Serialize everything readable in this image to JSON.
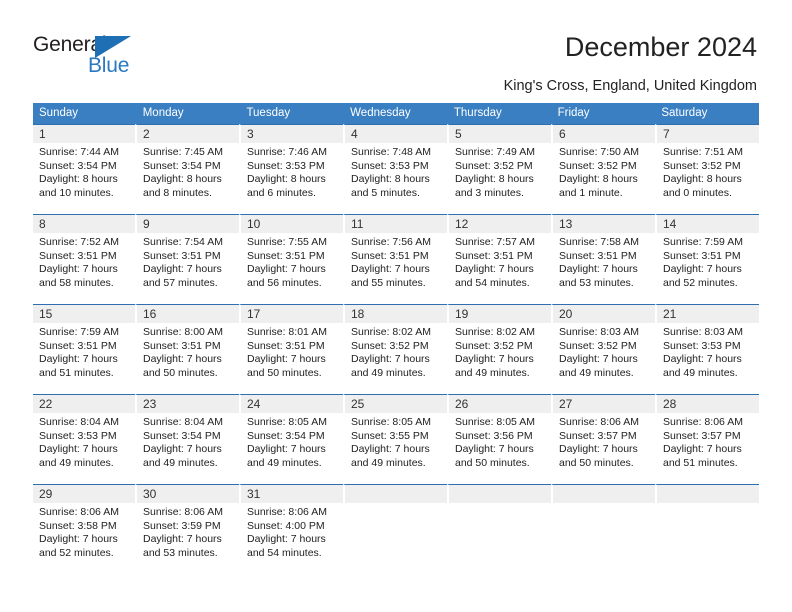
{
  "brand": {
    "name_top": "General",
    "name_bottom": "Blue",
    "accent_color": "#1f6fb4"
  },
  "header": {
    "title": "December 2024",
    "subtitle": "King's Cross, England, United Kingdom"
  },
  "calendar": {
    "header_bg": "#3a7fc1",
    "cell_header_bg": "#efefef",
    "cell_border_color": "#2f6fb0",
    "weekdays": [
      "Sunday",
      "Monday",
      "Tuesday",
      "Wednesday",
      "Thursday",
      "Friday",
      "Saturday"
    ],
    "weeks": [
      [
        {
          "day": "1",
          "sunrise": "Sunrise: 7:44 AM",
          "sunset": "Sunset: 3:54 PM",
          "daylight_line1": "Daylight: 8 hours",
          "daylight_line2": "and 10 minutes."
        },
        {
          "day": "2",
          "sunrise": "Sunrise: 7:45 AM",
          "sunset": "Sunset: 3:54 PM",
          "daylight_line1": "Daylight: 8 hours",
          "daylight_line2": "and 8 minutes."
        },
        {
          "day": "3",
          "sunrise": "Sunrise: 7:46 AM",
          "sunset": "Sunset: 3:53 PM",
          "daylight_line1": "Daylight: 8 hours",
          "daylight_line2": "and 6 minutes."
        },
        {
          "day": "4",
          "sunrise": "Sunrise: 7:48 AM",
          "sunset": "Sunset: 3:53 PM",
          "daylight_line1": "Daylight: 8 hours",
          "daylight_line2": "and 5 minutes."
        },
        {
          "day": "5",
          "sunrise": "Sunrise: 7:49 AM",
          "sunset": "Sunset: 3:52 PM",
          "daylight_line1": "Daylight: 8 hours",
          "daylight_line2": "and 3 minutes."
        },
        {
          "day": "6",
          "sunrise": "Sunrise: 7:50 AM",
          "sunset": "Sunset: 3:52 PM",
          "daylight_line1": "Daylight: 8 hours",
          "daylight_line2": "and 1 minute."
        },
        {
          "day": "7",
          "sunrise": "Sunrise: 7:51 AM",
          "sunset": "Sunset: 3:52 PM",
          "daylight_line1": "Daylight: 8 hours",
          "daylight_line2": "and 0 minutes."
        }
      ],
      [
        {
          "day": "8",
          "sunrise": "Sunrise: 7:52 AM",
          "sunset": "Sunset: 3:51 PM",
          "daylight_line1": "Daylight: 7 hours",
          "daylight_line2": "and 58 minutes."
        },
        {
          "day": "9",
          "sunrise": "Sunrise: 7:54 AM",
          "sunset": "Sunset: 3:51 PM",
          "daylight_line1": "Daylight: 7 hours",
          "daylight_line2": "and 57 minutes."
        },
        {
          "day": "10",
          "sunrise": "Sunrise: 7:55 AM",
          "sunset": "Sunset: 3:51 PM",
          "daylight_line1": "Daylight: 7 hours",
          "daylight_line2": "and 56 minutes."
        },
        {
          "day": "11",
          "sunrise": "Sunrise: 7:56 AM",
          "sunset": "Sunset: 3:51 PM",
          "daylight_line1": "Daylight: 7 hours",
          "daylight_line2": "and 55 minutes."
        },
        {
          "day": "12",
          "sunrise": "Sunrise: 7:57 AM",
          "sunset": "Sunset: 3:51 PM",
          "daylight_line1": "Daylight: 7 hours",
          "daylight_line2": "and 54 minutes."
        },
        {
          "day": "13",
          "sunrise": "Sunrise: 7:58 AM",
          "sunset": "Sunset: 3:51 PM",
          "daylight_line1": "Daylight: 7 hours",
          "daylight_line2": "and 53 minutes."
        },
        {
          "day": "14",
          "sunrise": "Sunrise: 7:59 AM",
          "sunset": "Sunset: 3:51 PM",
          "daylight_line1": "Daylight: 7 hours",
          "daylight_line2": "and 52 minutes."
        }
      ],
      [
        {
          "day": "15",
          "sunrise": "Sunrise: 7:59 AM",
          "sunset": "Sunset: 3:51 PM",
          "daylight_line1": "Daylight: 7 hours",
          "daylight_line2": "and 51 minutes."
        },
        {
          "day": "16",
          "sunrise": "Sunrise: 8:00 AM",
          "sunset": "Sunset: 3:51 PM",
          "daylight_line1": "Daylight: 7 hours",
          "daylight_line2": "and 50 minutes."
        },
        {
          "day": "17",
          "sunrise": "Sunrise: 8:01 AM",
          "sunset": "Sunset: 3:51 PM",
          "daylight_line1": "Daylight: 7 hours",
          "daylight_line2": "and 50 minutes."
        },
        {
          "day": "18",
          "sunrise": "Sunrise: 8:02 AM",
          "sunset": "Sunset: 3:52 PM",
          "daylight_line1": "Daylight: 7 hours",
          "daylight_line2": "and 49 minutes."
        },
        {
          "day": "19",
          "sunrise": "Sunrise: 8:02 AM",
          "sunset": "Sunset: 3:52 PM",
          "daylight_line1": "Daylight: 7 hours",
          "daylight_line2": "and 49 minutes."
        },
        {
          "day": "20",
          "sunrise": "Sunrise: 8:03 AM",
          "sunset": "Sunset: 3:52 PM",
          "daylight_line1": "Daylight: 7 hours",
          "daylight_line2": "and 49 minutes."
        },
        {
          "day": "21",
          "sunrise": "Sunrise: 8:03 AM",
          "sunset": "Sunset: 3:53 PM",
          "daylight_line1": "Daylight: 7 hours",
          "daylight_line2": "and 49 minutes."
        }
      ],
      [
        {
          "day": "22",
          "sunrise": "Sunrise: 8:04 AM",
          "sunset": "Sunset: 3:53 PM",
          "daylight_line1": "Daylight: 7 hours",
          "daylight_line2": "and 49 minutes."
        },
        {
          "day": "23",
          "sunrise": "Sunrise: 8:04 AM",
          "sunset": "Sunset: 3:54 PM",
          "daylight_line1": "Daylight: 7 hours",
          "daylight_line2": "and 49 minutes."
        },
        {
          "day": "24",
          "sunrise": "Sunrise: 8:05 AM",
          "sunset": "Sunset: 3:54 PM",
          "daylight_line1": "Daylight: 7 hours",
          "daylight_line2": "and 49 minutes."
        },
        {
          "day": "25",
          "sunrise": "Sunrise: 8:05 AM",
          "sunset": "Sunset: 3:55 PM",
          "daylight_line1": "Daylight: 7 hours",
          "daylight_line2": "and 49 minutes."
        },
        {
          "day": "26",
          "sunrise": "Sunrise: 8:05 AM",
          "sunset": "Sunset: 3:56 PM",
          "daylight_line1": "Daylight: 7 hours",
          "daylight_line2": "and 50 minutes."
        },
        {
          "day": "27",
          "sunrise": "Sunrise: 8:06 AM",
          "sunset": "Sunset: 3:57 PM",
          "daylight_line1": "Daylight: 7 hours",
          "daylight_line2": "and 50 minutes."
        },
        {
          "day": "28",
          "sunrise": "Sunrise: 8:06 AM",
          "sunset": "Sunset: 3:57 PM",
          "daylight_line1": "Daylight: 7 hours",
          "daylight_line2": "and 51 minutes."
        }
      ],
      [
        {
          "day": "29",
          "sunrise": "Sunrise: 8:06 AM",
          "sunset": "Sunset: 3:58 PM",
          "daylight_line1": "Daylight: 7 hours",
          "daylight_line2": "and 52 minutes."
        },
        {
          "day": "30",
          "sunrise": "Sunrise: 8:06 AM",
          "sunset": "Sunset: 3:59 PM",
          "daylight_line1": "Daylight: 7 hours",
          "daylight_line2": "and 53 minutes."
        },
        {
          "day": "31",
          "sunrise": "Sunrise: 8:06 AM",
          "sunset": "Sunset: 4:00 PM",
          "daylight_line1": "Daylight: 7 hours",
          "daylight_line2": "and 54 minutes."
        },
        {
          "day": "",
          "sunrise": "",
          "sunset": "",
          "daylight_line1": "",
          "daylight_line2": ""
        },
        {
          "day": "",
          "sunrise": "",
          "sunset": "",
          "daylight_line1": "",
          "daylight_line2": ""
        },
        {
          "day": "",
          "sunrise": "",
          "sunset": "",
          "daylight_line1": "",
          "daylight_line2": ""
        },
        {
          "day": "",
          "sunrise": "",
          "sunset": "",
          "daylight_line1": "",
          "daylight_line2": ""
        }
      ]
    ]
  }
}
